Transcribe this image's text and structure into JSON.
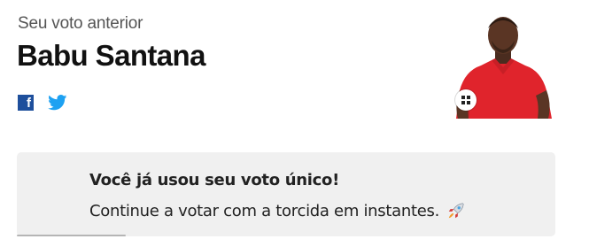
{
  "vote": {
    "previous_label": "Seu voto anterior",
    "candidate_name": "Babu Santana"
  },
  "share": {
    "facebook_icon": "facebook-icon",
    "facebook_glyph": "f",
    "twitter_icon": "twitter-icon"
  },
  "photo": {
    "shirt_color": "#e0242c",
    "expand_icon": "expand-icon"
  },
  "notice": {
    "title": "Você já usou seu voto único!",
    "message": "Continue a votar com a torcida em instantes.",
    "icon": "rocket-icon"
  },
  "colors": {
    "facebook": "#1e4f9c",
    "twitter": "#1da1f2",
    "notice_bg": "#f0f0f0"
  }
}
